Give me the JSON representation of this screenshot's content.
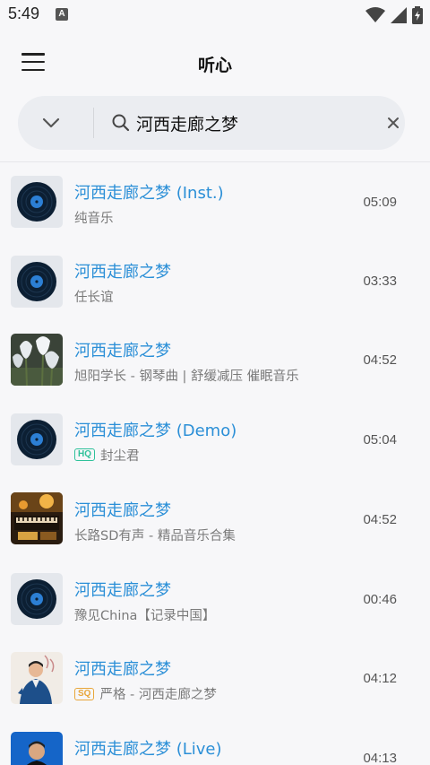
{
  "status_bar": {
    "time": "5:49",
    "notification_letter": "A"
  },
  "app_bar": {
    "title": "听心"
  },
  "search": {
    "query": "河西走廊之梦"
  },
  "songs": [
    {
      "title": "河西走廊之梦 (Inst.)",
      "artist": "纯音乐",
      "duration": "05:09",
      "art": "disc-icon",
      "badge": ""
    },
    {
      "title": "河西走廊之梦",
      "artist": "任长谊",
      "duration": "03:33",
      "art": "disc-icon",
      "badge": ""
    },
    {
      "title": "河西走廊之梦",
      "artist": "旭阳学长 - 钢琴曲 | 舒缓减压 催眠音乐",
      "duration": "04:52",
      "art": "tulip-photo",
      "badge": ""
    },
    {
      "title": "河西走廊之梦 (Demo)",
      "artist": "封尘君",
      "duration": "05:04",
      "art": "disc-icon",
      "badge": "HQ"
    },
    {
      "title": "河西走廊之梦",
      "artist": "长路SD有声 - 精品音乐合集",
      "duration": "04:52",
      "art": "piano-photo",
      "badge": ""
    },
    {
      "title": "河西走廊之梦",
      "artist": "豫见China【记录中国】",
      "duration": "00:46",
      "art": "disc-icon",
      "badge": ""
    },
    {
      "title": "河西走廊之梦",
      "artist": "严格 - 河西走廊之梦",
      "duration": "04:12",
      "art": "singer-photo",
      "badge": "SQ"
    },
    {
      "title": "河西走廊之梦 (Live)",
      "artist": "",
      "duration": "04:13",
      "art": "singer-blue-photo",
      "badge": ""
    }
  ]
}
